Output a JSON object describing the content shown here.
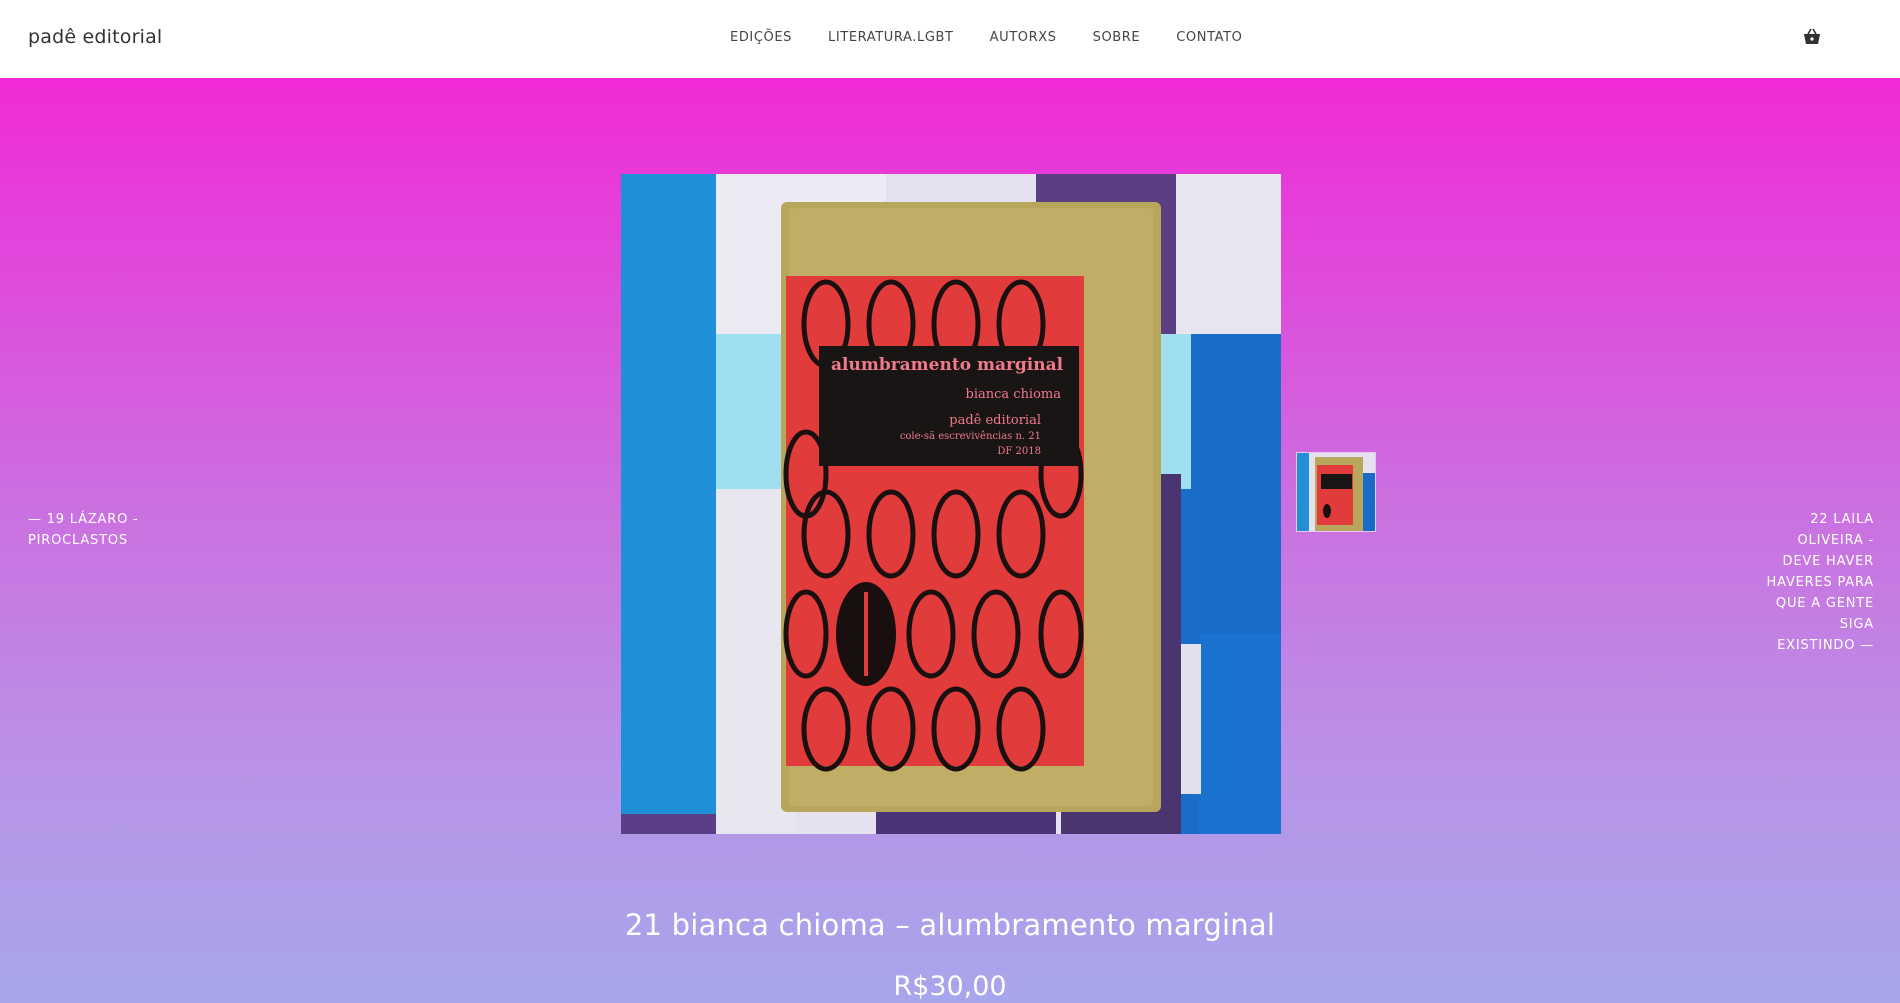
{
  "header": {
    "brand": "padê editorial",
    "nav": [
      "EDIÇÕES",
      "LITERATURA.LGBT",
      "AUTORXS",
      "SOBRE",
      "CONTATO"
    ],
    "cart_icon": "basket-icon"
  },
  "product": {
    "prev_link": "— 19 LÁZARO - PIROCLASTOS",
    "next_link": "22 LAILA OLIVEIRA - DEVE HAVER HAVERES PARA QUE A GENTE SIGA EXISTINDO —",
    "title": "21 bianca chioma – alumbramento marginal",
    "price": "R$30,00",
    "book_cover": {
      "title": "alumbramento marginal",
      "author": "bianca chioma",
      "publisher": "padê editorial",
      "series": "cole-sã escrevivências n. 21",
      "place_year": "DF 2018"
    }
  },
  "colors": {
    "gradient_top": "#f02ad6",
    "gradient_bottom": "#a7a6ec",
    "cover_red": "#e8393d",
    "kraft": "#b8a45a"
  }
}
